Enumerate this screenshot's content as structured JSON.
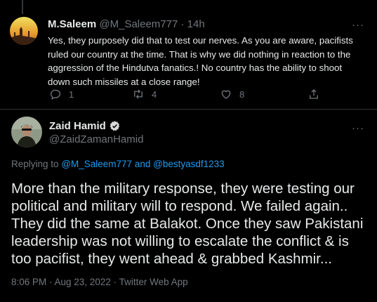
{
  "reply": {
    "author_name": "M.Saleem",
    "author_handle": "@M_Saleem777",
    "separator": "·",
    "time": "14h",
    "more": "···",
    "text": "Yes, they purposely did that to test our nerves. As you are aware, pacifists ruled our country at the time. That is why we did nothing in reaction to the aggression of the Hindutva fanatics.! No country has the ability to shoot down such missiles at a close range!",
    "actions": {
      "reply_count": "1",
      "retweet_count": "4",
      "like_count": "8"
    }
  },
  "main": {
    "author_name": "Zaid Hamid",
    "author_handle": "@ZaidZamanHamid",
    "verified_icon": "verified-badge-icon",
    "more": "···",
    "replying_prefix": "Replying to",
    "replying_user_1": "@M_Saleem777",
    "replying_and": "and",
    "replying_user_2": "@bestyasdf1233",
    "text": "More than the military response, they were testing our political and military will to respond. We failed again.. They did the same at Balakot. Once they saw Pakistani leadership was not willing to escalate the conflict & is too pacifist, they went ahead & grabbed Kashmir...",
    "meta": "8:06 PM · Aug 23, 2022 · Twitter Web App"
  },
  "colors": {
    "background": "#000000",
    "text": "#e7e9ea",
    "muted": "#71767b",
    "link": "#1d9bf0",
    "divider": "#2f3336"
  }
}
